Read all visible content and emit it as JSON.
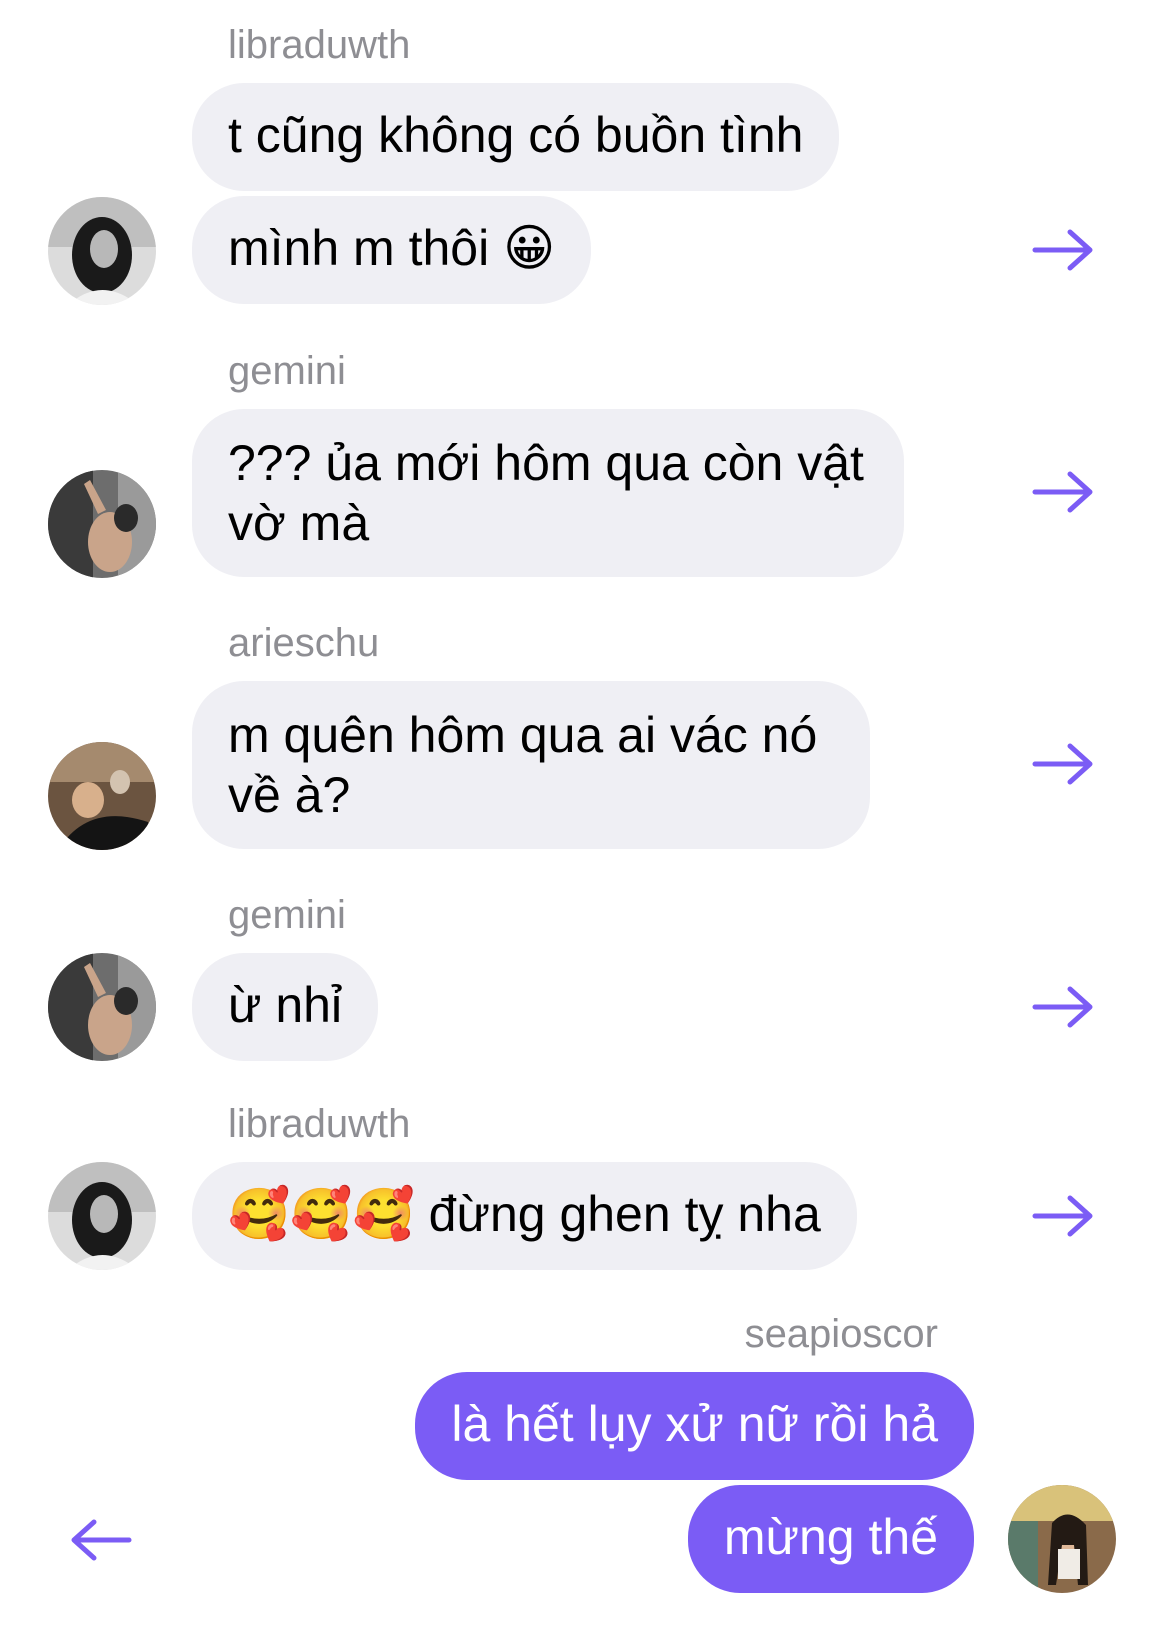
{
  "accent_color": "#7b5cf5",
  "bubble_color": "#efeff4",
  "messages": [
    {
      "sender": "libraduwth",
      "lines": [
        "t cũng không có buồn tình",
        "mình m thôi 😀"
      ]
    },
    {
      "sender": "gemini",
      "text": "??? ủa mới hôm qua còn vật vờ mà"
    },
    {
      "sender": "arieschu",
      "text": "m quên hôm qua ai vác nó về à?"
    },
    {
      "sender": "gemini",
      "text": "ừ nhỉ"
    },
    {
      "sender": "libraduwth",
      "text": "🥰🥰🥰 đừng ghen tỵ nha"
    },
    {
      "sender": "seapioscor",
      "lines": [
        "là hết lụy xử nữ rồi hả",
        "mừng thế"
      ]
    }
  ],
  "icons": {
    "forward": "right-arrow-icon",
    "back": "left-arrow-icon",
    "avatar": "user-avatar"
  }
}
